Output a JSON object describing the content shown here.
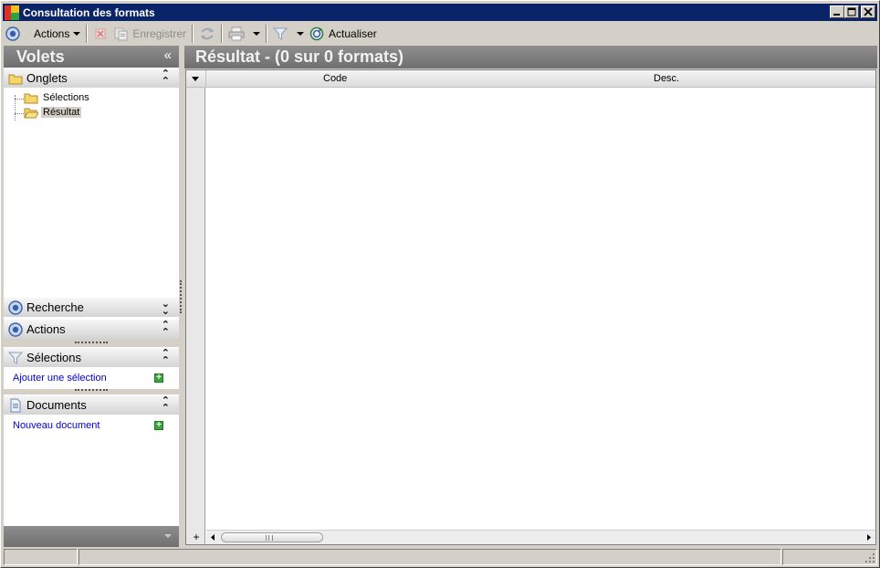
{
  "window": {
    "title": "Consultation des formats"
  },
  "toolbar": {
    "actions_label": "Actions",
    "save_label": "Enregistrer",
    "refresh_label": "Actualiser"
  },
  "left_pane": {
    "title": "Volets",
    "collapse_glyph": "«",
    "groups": {
      "onglets": {
        "label": "Onglets",
        "chevron": "up"
      },
      "recherche": {
        "label": "Recherche",
        "chevron": "down"
      },
      "actions": {
        "label": "Actions",
        "chevron": "up"
      },
      "selections": {
        "label": "Sélections",
        "chevron": "up",
        "link": "Ajouter une sélection"
      },
      "documents": {
        "label": "Documents",
        "chevron": "up",
        "link": "Nouveau document"
      }
    },
    "tree": [
      {
        "label": "Sélections",
        "selected": false
      },
      {
        "label": "Résultat",
        "selected": true
      }
    ]
  },
  "right_pane": {
    "title": "Résultat - (0 sur 0 formats)",
    "columns": [
      "Code",
      "Desc."
    ],
    "rows": []
  },
  "colors": {
    "titlebar": "#0a246a",
    "pane_header": "#7f7f7f",
    "link": "#0000cc",
    "add_icon": "#3aa53a"
  }
}
